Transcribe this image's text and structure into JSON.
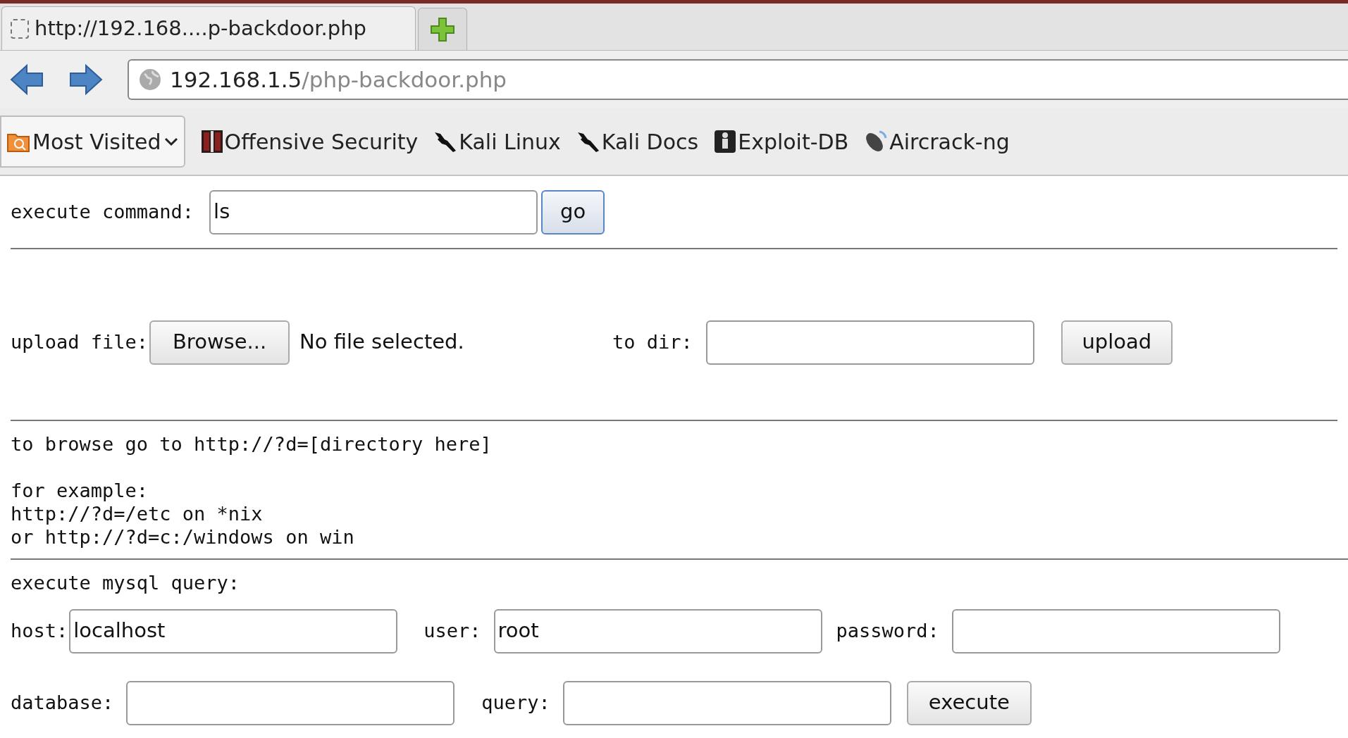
{
  "tab": {
    "title": "http://192.168....p-backdoor.php"
  },
  "address_bar": {
    "host": "192.168.1.5",
    "path": "/php-backdoor.php"
  },
  "bookmarks": [
    {
      "label": "Most Visited",
      "kind": "menu"
    },
    {
      "label": "Offensive Security",
      "kind": "link"
    },
    {
      "label": "Kali Linux",
      "kind": "link"
    },
    {
      "label": "Kali Docs",
      "kind": "link"
    },
    {
      "label": "Exploit-DB",
      "kind": "link"
    },
    {
      "label": "Aircrack-ng",
      "kind": "link"
    }
  ],
  "command": {
    "label": "execute command:",
    "value": "ls",
    "button": "go"
  },
  "upload": {
    "label": "upload file:",
    "browse_button": "Browse...",
    "file_status": "No file selected.",
    "dir_label": "to dir:",
    "button": "upload"
  },
  "browse_help": [
    "to browse go to http://?d=[directory here]",
    "for example:",
    "http://?d=/etc on *nix",
    "or http://?d=c:/windows on win"
  ],
  "mysql": {
    "heading": "execute mysql query:",
    "fields": [
      {
        "label": "host:",
        "value": "localhost"
      },
      {
        "label": "user:",
        "value": "root"
      },
      {
        "label": "password:"
      },
      {
        "label": "database:"
      },
      {
        "label": "query:"
      }
    ],
    "button": "execute"
  }
}
